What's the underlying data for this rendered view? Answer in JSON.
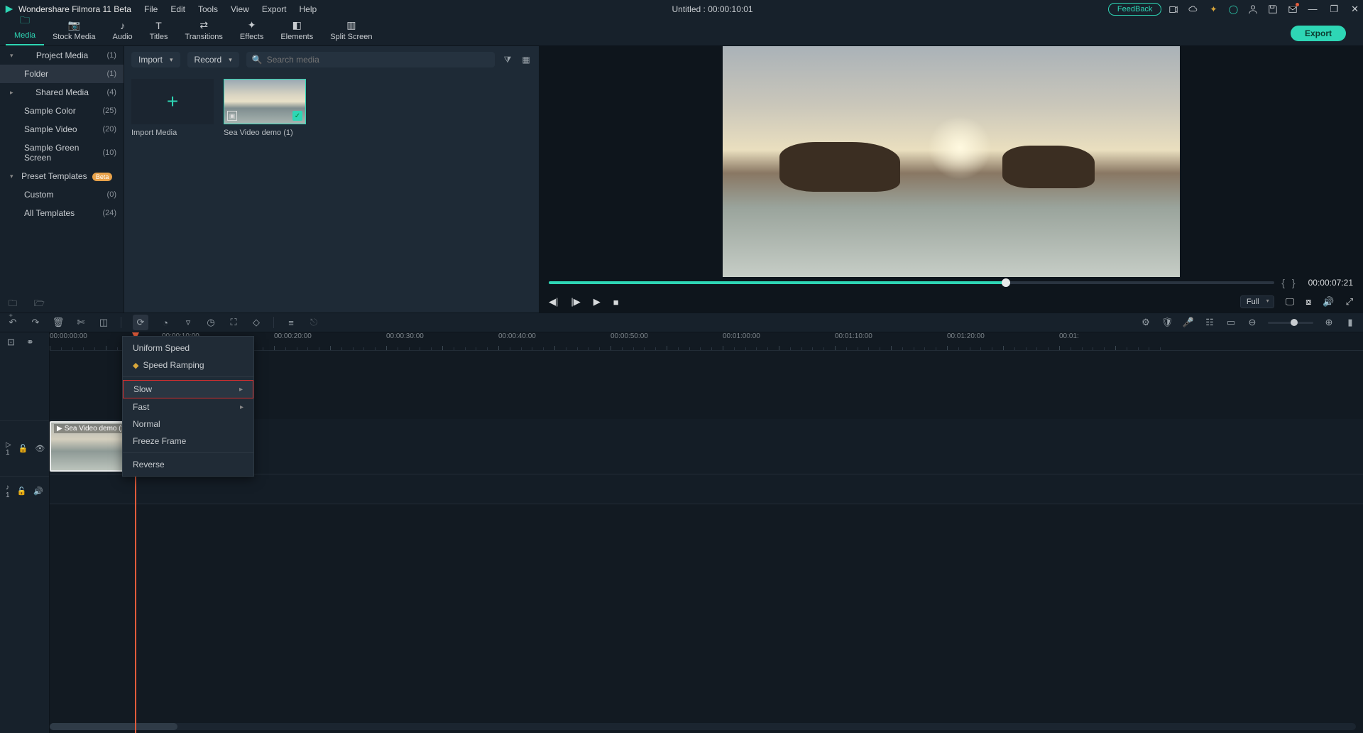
{
  "titlebar": {
    "app_name": "Wondershare Filmora 11 Beta",
    "menu": [
      "File",
      "Edit",
      "Tools",
      "View",
      "Export",
      "Help"
    ],
    "doc_title": "Untitled : 00:00:10:01",
    "feedback": "FeedBack"
  },
  "tabs": [
    {
      "label": "Media",
      "icon": "folder-icon",
      "active": true
    },
    {
      "label": "Stock Media",
      "icon": "camera-icon"
    },
    {
      "label": "Audio",
      "icon": "music-icon"
    },
    {
      "label": "Titles",
      "icon": "text-icon"
    },
    {
      "label": "Transitions",
      "icon": "transition-icon"
    },
    {
      "label": "Effects",
      "icon": "sparkle-icon"
    },
    {
      "label": "Elements",
      "icon": "shapes-icon"
    },
    {
      "label": "Split Screen",
      "icon": "split-icon"
    }
  ],
  "export_label": "Export",
  "sidebar": {
    "items": [
      {
        "label": "Project Media",
        "count": "(1)",
        "type": "collapsible",
        "open": true
      },
      {
        "label": "Folder",
        "count": "(1)",
        "type": "sub",
        "active": true
      },
      {
        "label": "Shared Media",
        "count": "(4)",
        "type": "collapsible",
        "open": false
      },
      {
        "label": "Sample Color",
        "count": "(25)",
        "type": "sub"
      },
      {
        "label": "Sample Video",
        "count": "(20)",
        "type": "sub"
      },
      {
        "label": "Sample Green Screen",
        "count": "(10)",
        "type": "sub"
      },
      {
        "label": "Preset Templates",
        "count": "",
        "type": "collapsible",
        "open": true,
        "badge": "Beta"
      },
      {
        "label": "Custom",
        "count": "(0)",
        "type": "sub"
      },
      {
        "label": "All Templates",
        "count": "(24)",
        "type": "sub"
      }
    ]
  },
  "mid_toolbar": {
    "import": "Import",
    "record": "Record",
    "search_placeholder": "Search media"
  },
  "media": {
    "items": [
      {
        "label": "Import Media",
        "type": "import"
      },
      {
        "label": "Sea Video demo (1)",
        "type": "video",
        "selected": true
      }
    ]
  },
  "preview": {
    "timecode": "00:00:07:21",
    "full_label": "Full"
  },
  "timeline": {
    "tracks": {
      "video": "▷ 1",
      "audio": "♪ 1"
    },
    "clip_name": "Sea Video demo (1)",
    "ruler_marks": [
      "00:00:00:00",
      "00:00:10:00",
      "00:00:20:00",
      "00:00:30:00",
      "00:00:40:00",
      "00:00:50:00",
      "00:01:00:00",
      "00:01:10:00",
      "00:01:20:00",
      "00:01:"
    ]
  },
  "context_menu": {
    "items": [
      {
        "label": "Uniform Speed"
      },
      {
        "label": "Speed Ramping",
        "diamond": true
      },
      {
        "sep": true
      },
      {
        "label": "Slow",
        "submenu": true,
        "highlight": true
      },
      {
        "label": "Fast",
        "submenu": true
      },
      {
        "label": "Normal"
      },
      {
        "label": "Freeze Frame"
      },
      {
        "sep": true
      },
      {
        "label": "Reverse"
      }
    ]
  }
}
